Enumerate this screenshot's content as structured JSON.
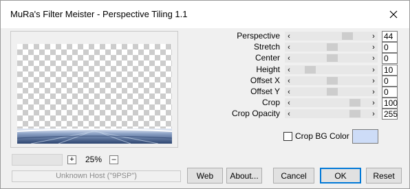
{
  "window": {
    "title": "MuRa's Filter Meister - Perspective Tiling 1.1"
  },
  "preview": {
    "zoom": "25%",
    "zoom_in": "+",
    "zoom_out": "–",
    "status": "Unknown Host (\"9PSP\")"
  },
  "params": [
    {
      "label": "Perspective",
      "value": "44",
      "position": 0.75
    },
    {
      "label": "Stretch",
      "value": "0",
      "position": 0.52
    },
    {
      "label": "Center",
      "value": "0",
      "position": 0.52
    },
    {
      "label": "Height",
      "value": "10",
      "position": 0.18
    },
    {
      "label": "Offset X",
      "value": "0",
      "position": 0.52
    },
    {
      "label": "Offset Y",
      "value": "0",
      "position": 0.52
    },
    {
      "label": "Crop",
      "value": "100",
      "position": 0.86
    },
    {
      "label": "Crop Opacity",
      "value": "255",
      "position": 0.86
    }
  ],
  "crop_bg": {
    "label": "Crop BG Color",
    "checked": false,
    "color": "#cddcf7"
  },
  "buttons": {
    "web": "Web",
    "about": "About...",
    "cancel": "Cancel",
    "ok": "OK",
    "reset": "Reset"
  },
  "icons": {
    "slider_left": "‹",
    "slider_right": "›"
  }
}
